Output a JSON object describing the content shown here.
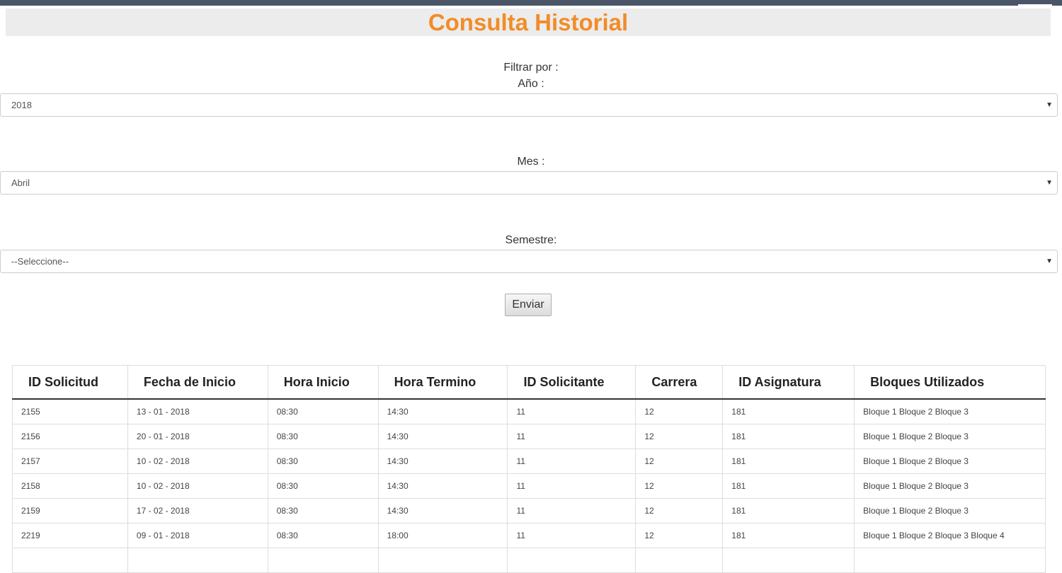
{
  "page": {
    "title": "Consulta Historial"
  },
  "colors": {
    "title_orange": "#f28c28",
    "topbar": "#4a5568",
    "title_band": "#ececec"
  },
  "filter": {
    "heading": "Filtrar por :",
    "year_label": "Año :",
    "year_value": "2018",
    "month_label": "Mes :",
    "month_value": "Abril",
    "semester_label": "Semestre:",
    "semester_value": "--Seleccione--",
    "caret_icon": "▼",
    "submit_label": "Enviar"
  },
  "table": {
    "headers": [
      "ID Solicitud",
      "Fecha de Inicio",
      "Hora Inicio",
      "Hora Termino",
      "ID Solicitante",
      "Carrera",
      "ID Asignatura",
      "Bloques Utilizados"
    ],
    "rows": [
      [
        "2155",
        "13 - 01 - 2018",
        "08:30",
        "14:30",
        "11",
        "12",
        "181",
        "Bloque 1 Bloque 2 Bloque 3"
      ],
      [
        "2156",
        "20 - 01 - 2018",
        "08:30",
        "14:30",
        "11",
        "12",
        "181",
        "Bloque 1 Bloque 2 Bloque 3"
      ],
      [
        "2157",
        "10 - 02 - 2018",
        "08:30",
        "14:30",
        "11",
        "12",
        "181",
        "Bloque 1 Bloque 2 Bloque 3"
      ],
      [
        "2158",
        "10 - 02 - 2018",
        "08:30",
        "14:30",
        "11",
        "12",
        "181",
        "Bloque 1 Bloque 2 Bloque 3"
      ],
      [
        "2159",
        "17 - 02 - 2018",
        "08:30",
        "14:30",
        "11",
        "12",
        "181",
        "Bloque 1 Bloque 2 Bloque 3"
      ],
      [
        "2219",
        "09 - 01 - 2018",
        "08:30",
        "18:00",
        "11",
        "12",
        "181",
        "Bloque 1 Bloque 2 Bloque 3 Bloque 4"
      ],
      [
        "",
        "",
        "",
        "",
        "",
        "",
        "",
        ""
      ]
    ]
  }
}
